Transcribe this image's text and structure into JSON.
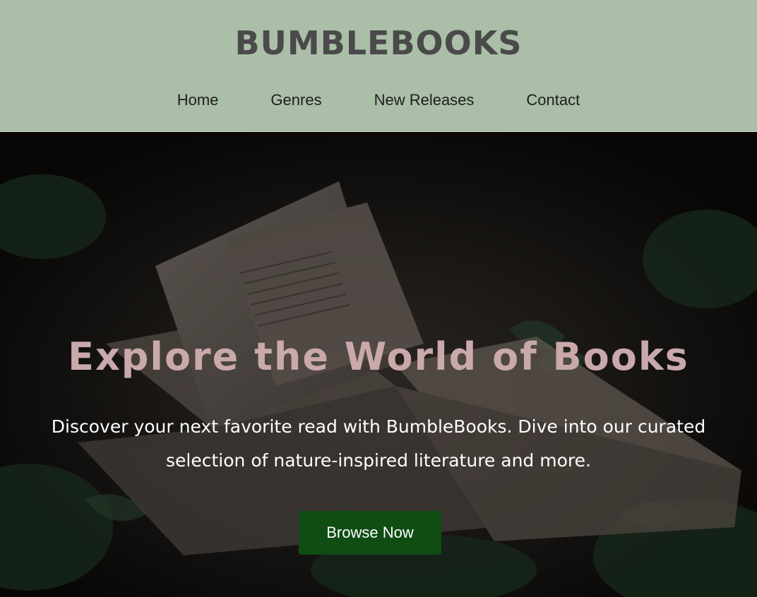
{
  "header": {
    "brand": "BUMBLEBOOKS",
    "nav": [
      {
        "label": "Home"
      },
      {
        "label": "Genres"
      },
      {
        "label": "New Releases"
      },
      {
        "label": "Contact"
      }
    ],
    "background_color": "#abbfa8"
  },
  "hero": {
    "title": "Explore the World of Books",
    "description": "Discover your next favorite read with BumbleBooks. Dive into our curated selection of nature-inspired literature and more.",
    "cta_label": "Browse Now",
    "title_color": "#c9a9ab",
    "cta_color": "#0f4d13",
    "background_image": "open-book-among-ivy-leaves"
  }
}
